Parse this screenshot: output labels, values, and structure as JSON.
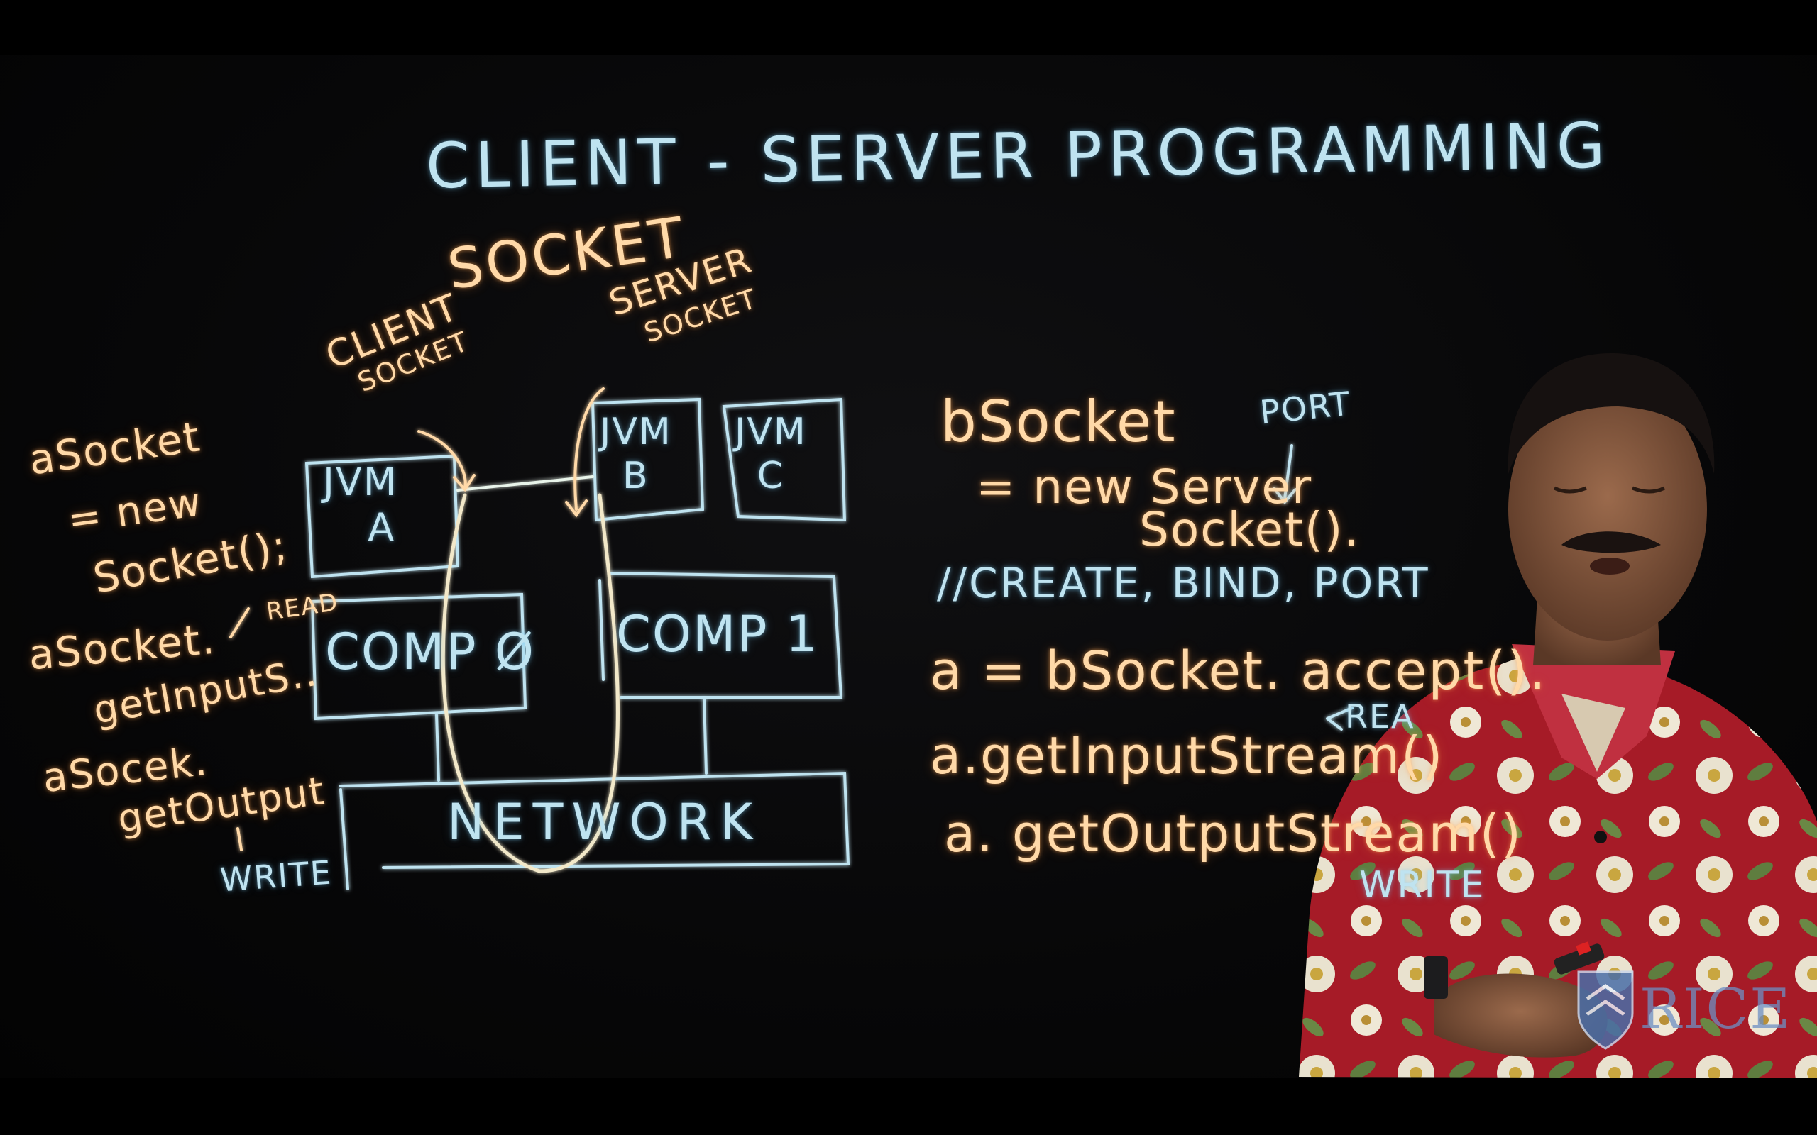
{
  "board": {
    "title": "CLIENT - SERVER   PROGRAMMING",
    "socket_heading": "SOCKET",
    "client_socket_label": "CLIENT",
    "client_socket_sub": "SOCKET",
    "server_socket_label": "SERVER",
    "server_socket_sub": "SOCKET",
    "jvm_a": [
      "JVM",
      "A"
    ],
    "jvm_b": [
      "JVM",
      "B"
    ],
    "jvm_c": [
      "JVM",
      "C"
    ],
    "comp0": "COMP Ø",
    "comp1": "COMP 1",
    "network": "NETWORK",
    "left_code": {
      "line1": "aSocket",
      "line2": "= new",
      "line3": "Socket();",
      "read_label": "READ",
      "line4": "aSocket.",
      "line5": "getInputS..",
      "line6": "aSocek.",
      "line7": "getOutput",
      "write_label": "WRITE"
    },
    "right_code": {
      "line1": "bSocket",
      "port_label": "PORT",
      "line2": "= new Server",
      "line3": "Socket().",
      "line4": "//CREATE, BIND, PORT",
      "line5": "a = bSocket. accept().",
      "line6": "a.getInputStream()",
      "read_label": "REA",
      "line7": "a. getOutputStream()",
      "write_label": "WRITE"
    }
  },
  "logo": {
    "text": "RICE"
  },
  "colors": {
    "chalk_blue": "#bfe3f0",
    "chalk_orange": "#ffd9a8",
    "shirt_red": "#b0202c"
  }
}
